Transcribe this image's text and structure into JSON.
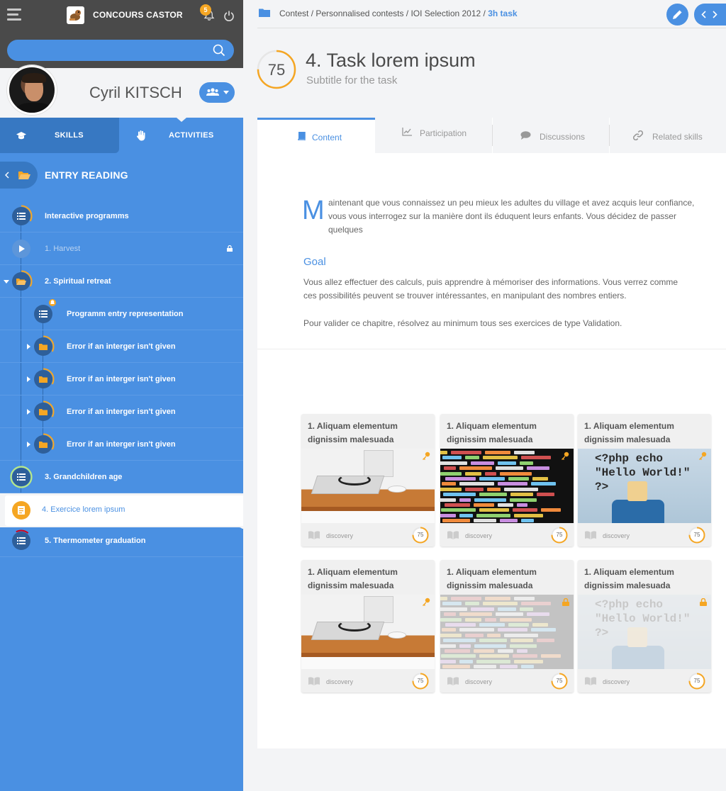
{
  "app": {
    "title": "CONCOURS CASTOR",
    "notification_count": "5"
  },
  "search": {
    "placeholder": ""
  },
  "user": {
    "name": "Cyril KITSCH"
  },
  "left_tabs": {
    "skills": "SKILLS",
    "activities": "ACTIVITIES"
  },
  "tree": {
    "header": "ENTRY READING",
    "items": [
      {
        "label": "Interactive programms",
        "icon": "list-icon",
        "state": "normal"
      },
      {
        "label": "1. Harvest",
        "icon": "play-icon",
        "state": "locked"
      },
      {
        "label": "2. Spiritual retreat",
        "icon": "folder-open-icon",
        "state": "expanded"
      },
      {
        "label": "Programm entry representation",
        "icon": "list-icon",
        "state": "notified"
      },
      {
        "label": "Error if an interger isn't given",
        "icon": "folder-icon",
        "state": "collapsed"
      },
      {
        "label": "Error if an interger isn't given",
        "icon": "folder-icon",
        "state": "collapsed"
      },
      {
        "label": "Error if an interger isn't given",
        "icon": "folder-icon",
        "state": "collapsed"
      },
      {
        "label": "Error if an interger isn't given",
        "icon": "folder-icon",
        "state": "collapsed"
      },
      {
        "label": "3. Grandchildren age",
        "icon": "list-icon",
        "state": "normal"
      },
      {
        "label": "4. Exercice lorem ipsum",
        "icon": "document-icon",
        "state": "active"
      },
      {
        "label": "5. Thermometer graduation",
        "icon": "list-icon",
        "state": "normal"
      }
    ]
  },
  "breadcrumb": {
    "path": [
      "Contest",
      "Personnalised contests",
      "IOI Selection 2012"
    ],
    "separator": " / ",
    "current": "3h task"
  },
  "task": {
    "score": "75",
    "score_fraction": 0.75,
    "title": "4. Task lorem ipsum",
    "subtitle": "Subtitle for the task"
  },
  "content_tabs": [
    {
      "label": "Content",
      "icon": "book-icon",
      "active": true
    },
    {
      "label": "Participation",
      "icon": "chart-line-icon",
      "active": false
    },
    {
      "label": "Discussions",
      "icon": "comment-icon",
      "active": false
    },
    {
      "label": "Related skills",
      "icon": "link-icon",
      "active": false
    }
  ],
  "content": {
    "dropcap": "M",
    "intro": "aintenant que vous connaissez un peu mieux les adultes du village et avez acquis leur confiance, vous vous interrogez sur la manière dont ils éduquent leurs enfants. Vous décidez de passer quelques",
    "goal_title": "Goal",
    "goal_p1": "Vous allez effectuer des calculs, puis apprendre à mémoriser des informations. Vous verrez comme ces possibilités peuvent se trouver intéressantes, en manipulant des nombres entiers.",
    "goal_p2": "Pour valider ce chapitre, résolvez au minimum tous ses exercices de type Validation."
  },
  "cards": [
    {
      "title": "1. Aliquam elementum dignissim malesuada",
      "type": "discovery",
      "score": "75",
      "image": "desk",
      "status": "key"
    },
    {
      "title": "1. Aliquam elementum dignissim malesuada",
      "type": "discovery",
      "score": "75",
      "image": "code",
      "status": "key"
    },
    {
      "title": "1. Aliquam elementum dignissim malesuada",
      "type": "discovery",
      "score": "75",
      "image": "php",
      "status": "key"
    },
    {
      "title": "1. Aliquam elementum dignissim malesuada",
      "type": "discovery",
      "score": "75",
      "image": "desk",
      "status": "key"
    },
    {
      "title": "1. Aliquam elementum dignissim malesuada",
      "type": "discovery",
      "score": "75",
      "image": "code",
      "status": "locked"
    },
    {
      "title": "1. Aliquam elementum dignissim malesuada",
      "type": "discovery",
      "score": "75",
      "image": "php",
      "status": "locked"
    }
  ],
  "php_image_text": "<?php echo\n\"Hello World!\"\n?>",
  "colors": {
    "accent": "#4a90e2",
    "dark": "#4a4a4a",
    "orange": "#f5a623",
    "green": "#7ed321"
  }
}
